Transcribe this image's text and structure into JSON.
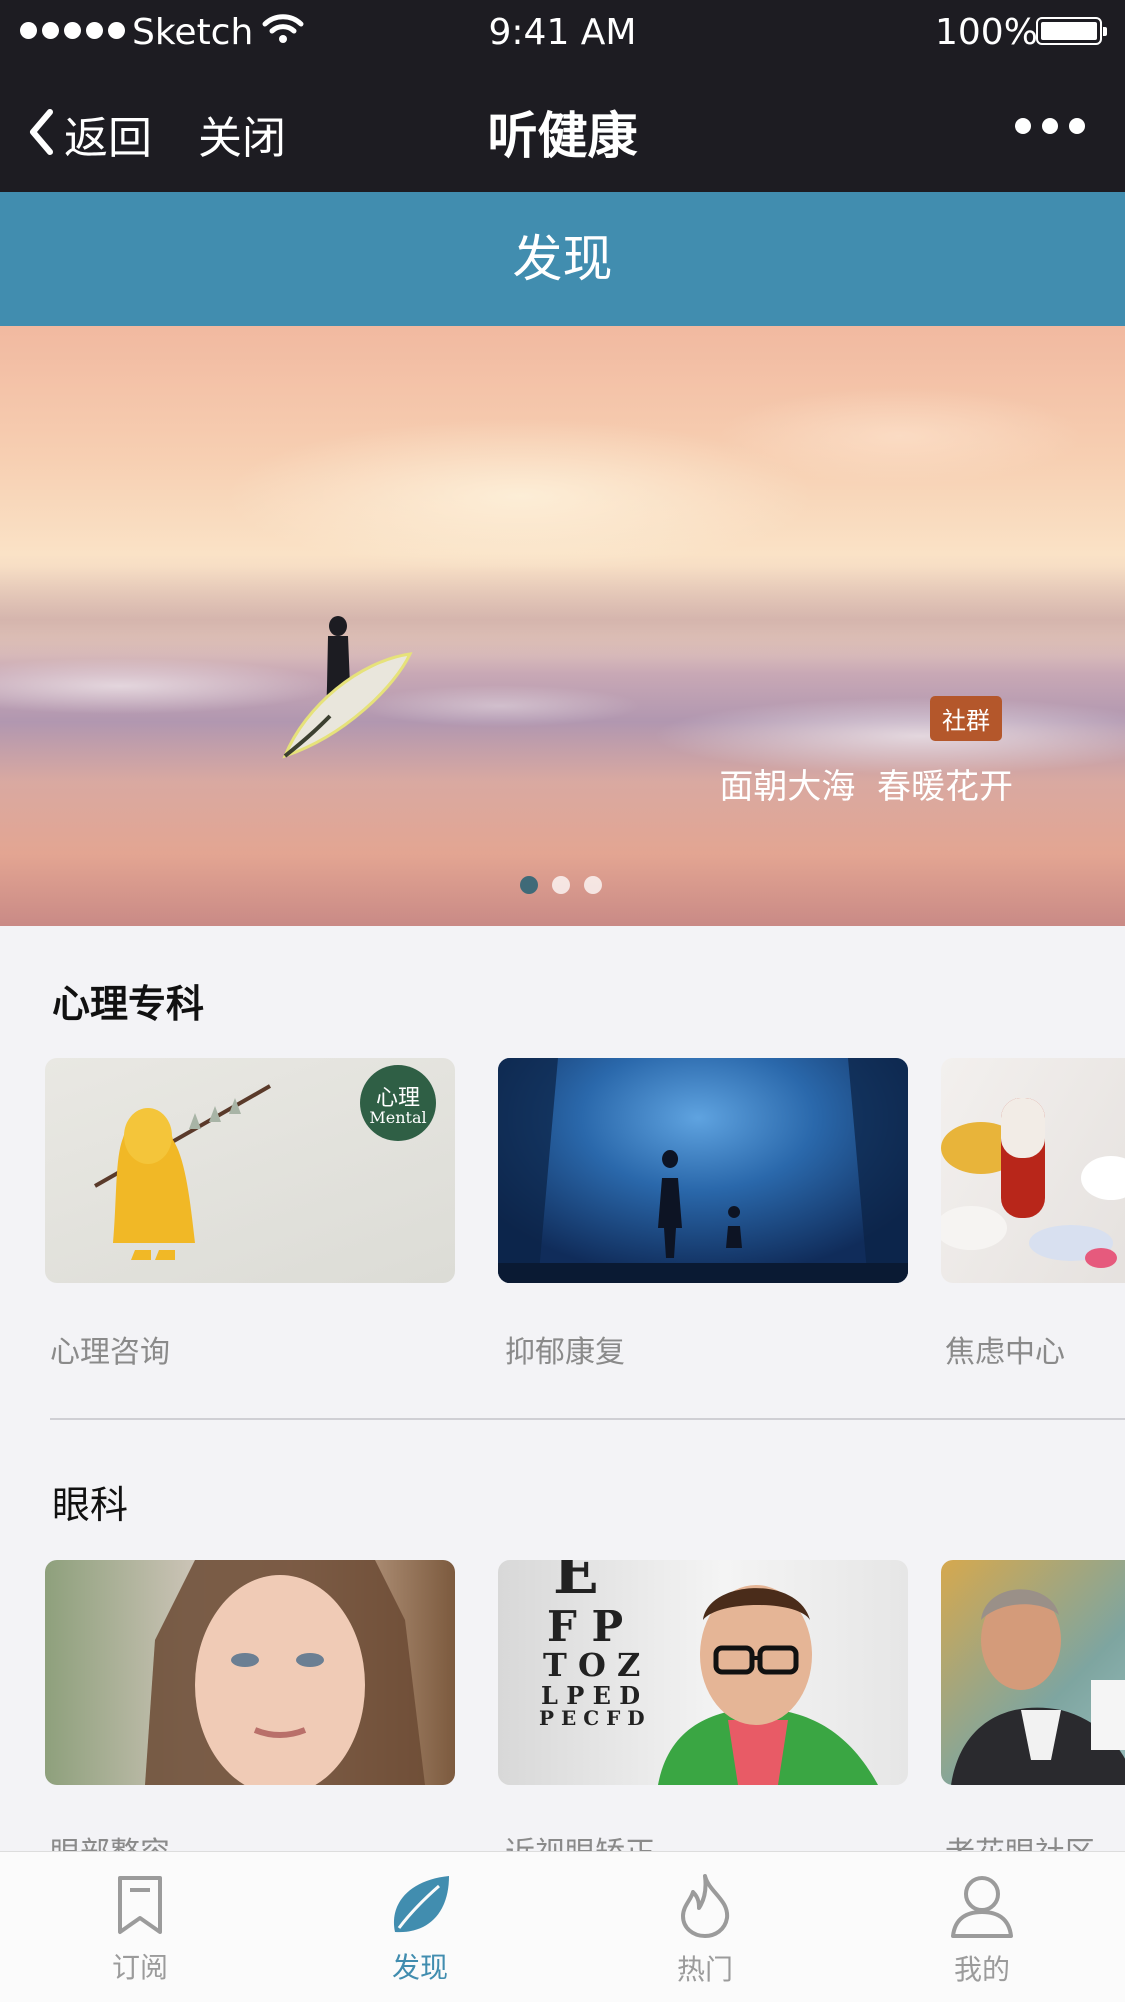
{
  "status_bar": {
    "carrier": "Sketch",
    "time": "9:41 AM",
    "battery": "100%"
  },
  "nav": {
    "back_label": "返回",
    "close_label": "关闭",
    "title": "听健康"
  },
  "section_header": "发现",
  "banner": {
    "badge": "社群",
    "caption": "面朝大海  春暖花开",
    "page_count": 3,
    "active_page": 1
  },
  "categories": [
    {
      "title": "心理专科",
      "items": [
        {
          "label": "心理咨询",
          "badge_top": "心理",
          "badge_bottom": "Mental"
        },
        {
          "label": "抑郁康复"
        },
        {
          "label": "焦虑中心"
        }
      ]
    },
    {
      "title": "眼科",
      "items": [
        {
          "label": "眼部整容"
        },
        {
          "label": "近视眼矫正",
          "chart_lines": [
            "E",
            "F P",
            "T O Z",
            "L P E D",
            "P E C F D"
          ]
        },
        {
          "label": "老花眼社区"
        }
      ]
    }
  ],
  "tabbar": [
    {
      "label": "订阅",
      "icon": "bookmark-icon"
    },
    {
      "label": "发现",
      "icon": "leaf-icon",
      "active": true
    },
    {
      "label": "热门",
      "icon": "flame-icon"
    },
    {
      "label": "我的",
      "icon": "user-icon"
    }
  ],
  "colors": {
    "primary": "#418daf",
    "navbar": "#1d1c22",
    "badge": "#b4572b",
    "page_bg": "#f3f3f6"
  }
}
